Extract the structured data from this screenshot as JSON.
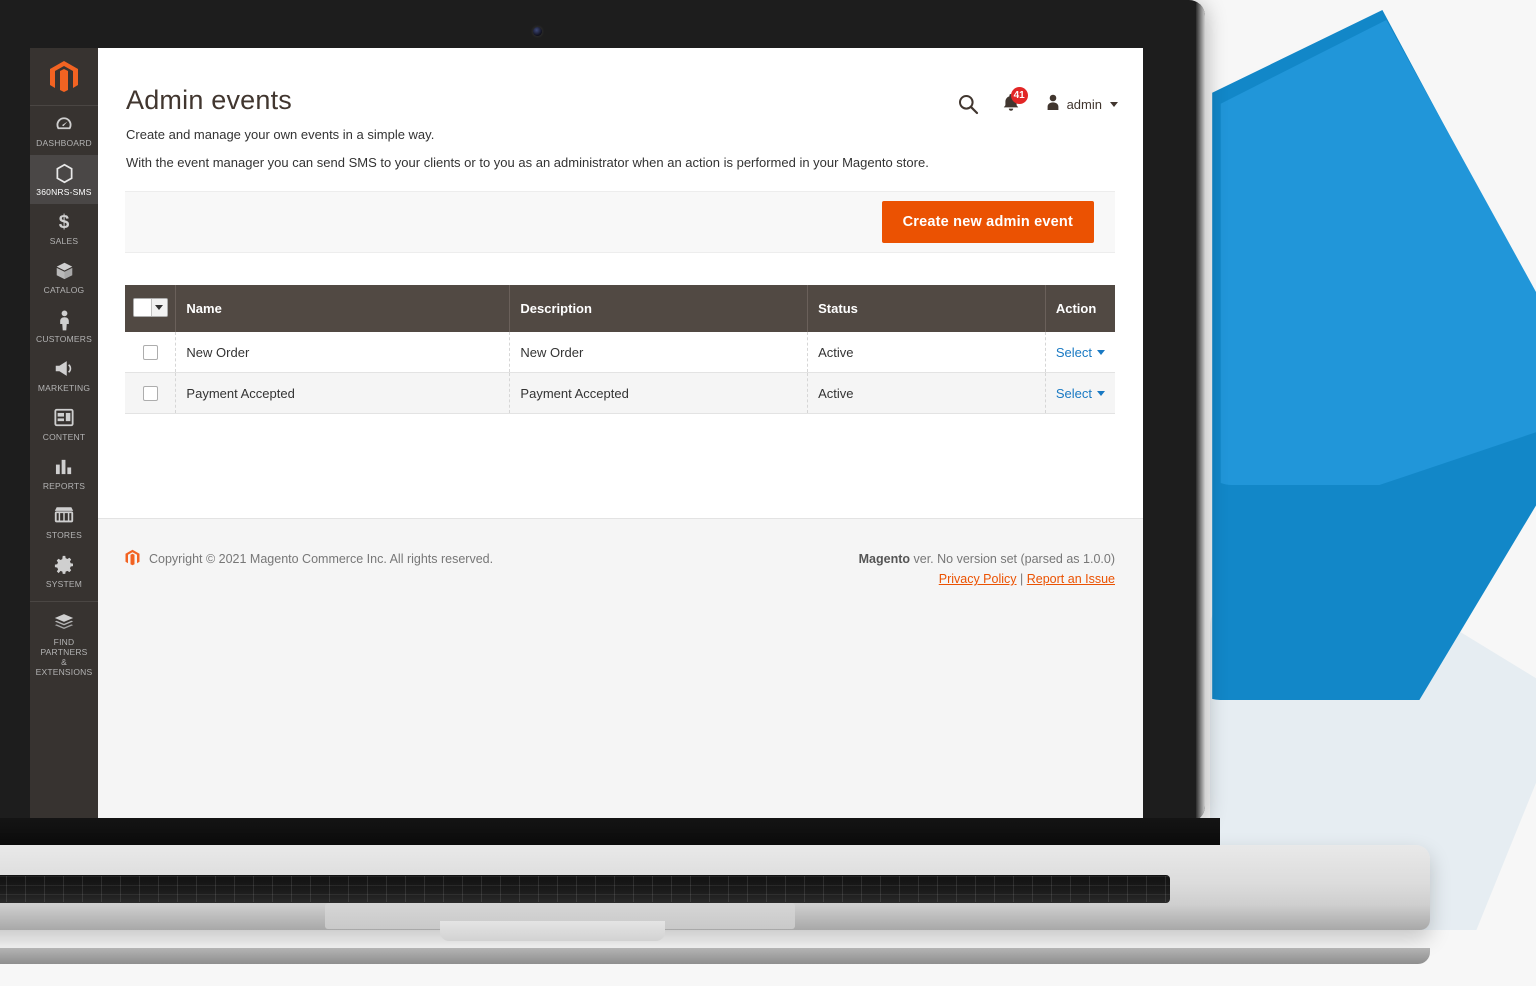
{
  "sidebar": {
    "logo_icon": "magento-logo-icon",
    "items": [
      {
        "label": "DASHBOARD",
        "icon": "dashboard-icon",
        "glyph": "◕",
        "active": false
      },
      {
        "label": "360NRS-SMS",
        "icon": "hexagon-icon",
        "glyph": "⬡",
        "active": true
      },
      {
        "label": "SALES",
        "icon": "dollar-icon",
        "glyph": "$",
        "active": false
      },
      {
        "label": "CATALOG",
        "icon": "box-icon",
        "glyph": "◳",
        "active": false
      },
      {
        "label": "CUSTOMERS",
        "icon": "person-icon",
        "glyph": "👤",
        "active": false
      },
      {
        "label": "MARKETING",
        "icon": "megaphone-icon",
        "glyph": "📣",
        "active": false
      },
      {
        "label": "CONTENT",
        "icon": "layout-icon",
        "glyph": "▥",
        "active": false
      },
      {
        "label": "REPORTS",
        "icon": "bar-chart-icon",
        "glyph": "▁▄█",
        "active": false
      },
      {
        "label": "STORES",
        "icon": "storefront-icon",
        "glyph": "🏪",
        "active": false
      },
      {
        "label": "SYSTEM",
        "icon": "gear-icon",
        "glyph": "⚙",
        "active": false
      },
      {
        "label": "FIND PARTNERS\n& EXTENSIONS",
        "icon": "extensions-icon",
        "glyph": "◰",
        "active": false
      }
    ]
  },
  "header": {
    "title": "Admin events",
    "intro_line_1": "Create and manage your own events in a simple way.",
    "intro_line_2": "With the event manager you can send SMS to your clients or to you as an administrator when an action is performed in your Magento store.",
    "search_icon": "search-icon",
    "notifications_icon": "bell-icon",
    "notifications_count": "41",
    "user_icon": "user-avatar-icon",
    "user_name": "admin"
  },
  "toolbar": {
    "create_label": "Create new admin event"
  },
  "grid": {
    "select_all_icon": "select-all-dropdown-icon",
    "columns": [
      "Name",
      "Description",
      "Status",
      "Action"
    ],
    "rows": [
      {
        "name": "New Order",
        "description": "New Order",
        "status": "Active",
        "action": "Select"
      },
      {
        "name": "Payment Accepted",
        "description": "Payment Accepted",
        "status": "Active",
        "action": "Select"
      }
    ]
  },
  "footer": {
    "logo_icon": "magento-footer-logo-icon",
    "copyright": "Copyright © 2021 Magento Commerce Inc. All rights reserved.",
    "brand": "Magento",
    "version": " ver. No version set (parsed as 1.0.0)",
    "privacy_label": "Privacy Policy",
    "separator": "|",
    "report_label": "Report an Issue"
  },
  "colors": {
    "accent_orange": "#eb5202",
    "sidebar_bg": "#373330",
    "grid_header_bg": "#514943",
    "link_blue": "#1979c3",
    "badge_red": "#e22626",
    "shape_blue": "#1287c8",
    "shape_blue_light": "#2196d9",
    "shape_pale": "#e6edf2"
  }
}
